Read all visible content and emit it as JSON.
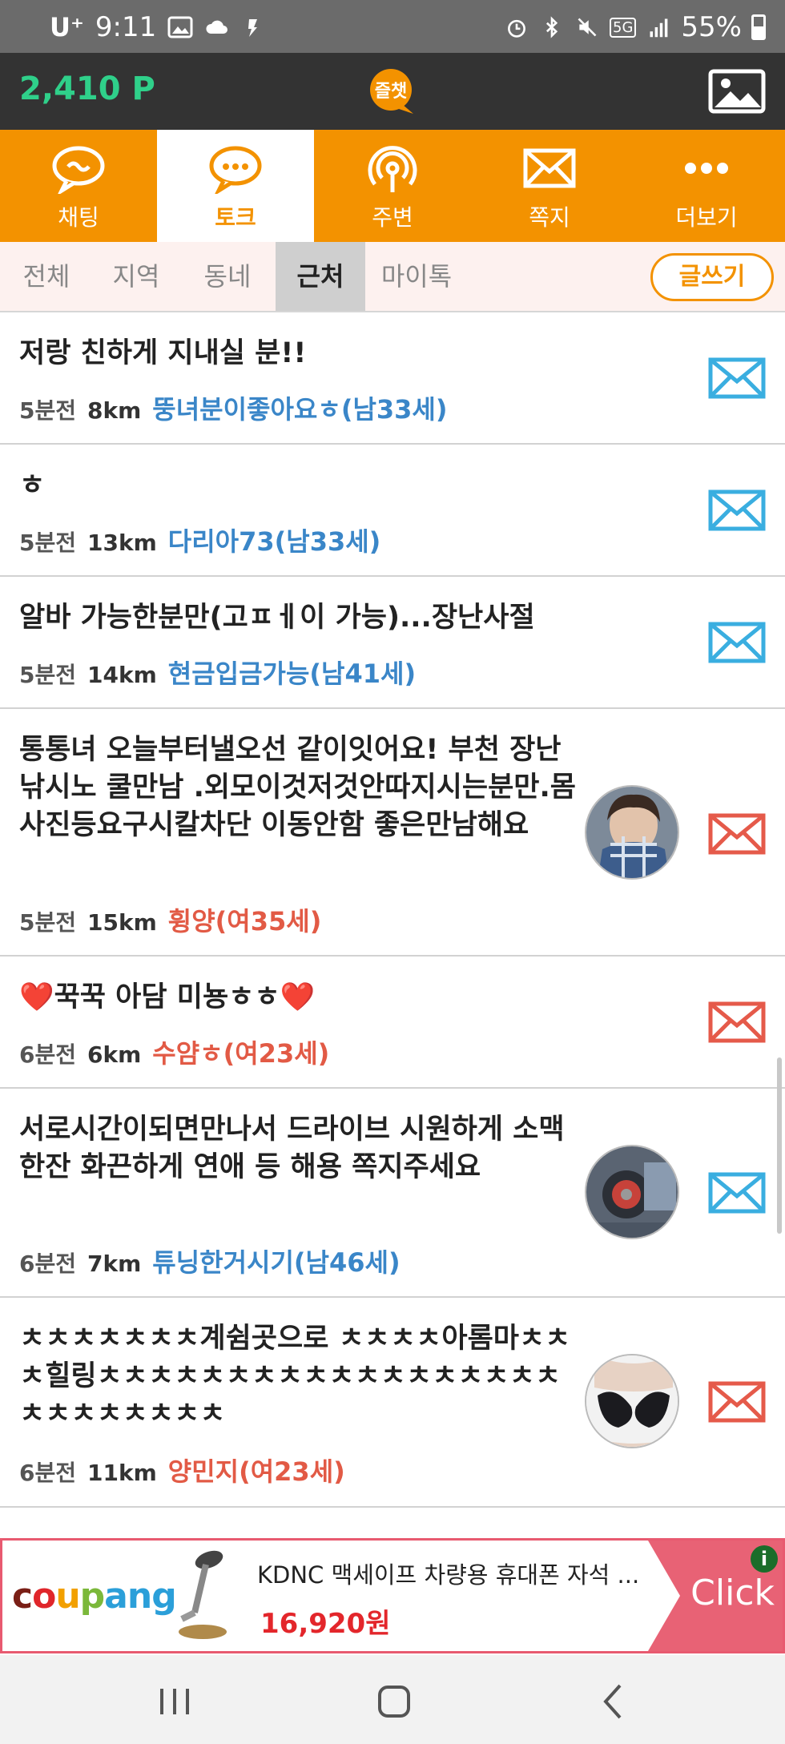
{
  "status_bar": {
    "carrier": "U⁺",
    "time": "9:11",
    "network": "5G",
    "battery": "55%"
  },
  "header": {
    "points": "2,410 P",
    "logo_text": "즐챗",
    "photo_icon": "image-icon"
  },
  "main_tabs": [
    {
      "label": "채팅",
      "icon": "chat-bubble-icon",
      "active": false
    },
    {
      "label": "토크",
      "icon": "talk-bubble-icon",
      "active": true
    },
    {
      "label": "주변",
      "icon": "broadcast-icon",
      "active": false
    },
    {
      "label": "쪽지",
      "icon": "envelope-icon",
      "active": false
    },
    {
      "label": "더보기",
      "icon": "more-dots-icon",
      "active": false
    }
  ],
  "sub_tabs": [
    {
      "label": "전체",
      "active": false
    },
    {
      "label": "지역",
      "active": false
    },
    {
      "label": "동네",
      "active": false
    },
    {
      "label": "근처",
      "active": true
    },
    {
      "label": "마이톡",
      "active": false
    }
  ],
  "write_button": "글쓰기",
  "posts": [
    {
      "title": "저랑 친하게 지내실 분!!",
      "time": "5분전",
      "distance": "8km",
      "nickname": "뚱녀분이좋아요ㅎ(남33세)",
      "gender": "m",
      "has_avatar": false
    },
    {
      "title": "ㅎ",
      "time": "5분전",
      "distance": "13km",
      "nickname": "다리아73(남33세)",
      "gender": "m",
      "has_avatar": false
    },
    {
      "title": "알바 가능한분만(고ㅍㅔ이 가능)...장난사절",
      "time": "5분전",
      "distance": "14km",
      "nickname": "현금입금가능(남41세)",
      "gender": "m",
      "has_avatar": false
    },
    {
      "title": "통통녀 오늘부터낼오선 같이잇어요! 부천 장난낚시노 쿨만남 .외모이것저것안따지시는분만.몸사진등요구시칼차단 이동안함 좋은만남해요",
      "time": "5분전",
      "distance": "15km",
      "nickname": "휭양(여35세)",
      "gender": "f",
      "has_avatar": true
    },
    {
      "title": "❤️꾹꾹 아담 미뇽ㅎㅎ❤️",
      "time": "6분전",
      "distance": "6km",
      "nickname": "수얌ㅎ(여23세)",
      "gender": "f",
      "has_avatar": false
    },
    {
      "title": "서로시간이되면만나서  드라이브 시원하게 소맥  한잔 화끈하게  연애 등 해용   쪽지주세요",
      "time": "6분전",
      "distance": "7km",
      "nickname": "튜닝한거시기(남46세)",
      "gender": "m",
      "has_avatar": true
    },
    {
      "title": "ㅊㅊㅊㅊㅊㅊㅊ계쉼곳으로 ㅊㅊㅊㅊ아롬마ㅊㅊㅊ힐링ㅊㅊㅊㅊㅊㅊㅊㅊㅊㅊㅊㅊㅊㅊㅊㅊㅊㅊㅊㅊㅊㅊㅊㅊㅊㅊ",
      "time": "6분전",
      "distance": "11km",
      "nickname": "양민지(여23세)",
      "gender": "f",
      "has_avatar": true
    }
  ],
  "ad": {
    "brand": "coupang",
    "title": "KDNC 맥세이프 차량용 휴대폰 자석 ...",
    "price": "16,920원",
    "cta": "Click",
    "info": "i"
  },
  "colors": {
    "accent": "#f39200",
    "male": "#3a86c8",
    "female": "#e25a45",
    "points": "#2fd08a"
  }
}
